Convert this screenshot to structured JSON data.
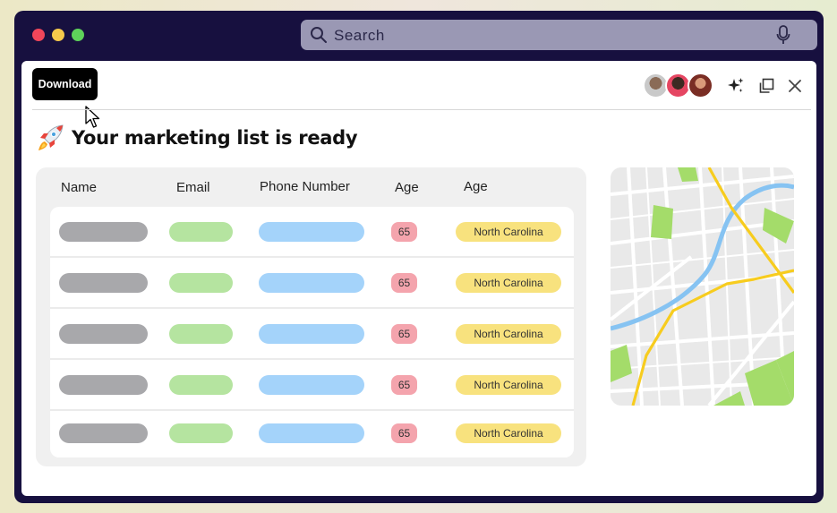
{
  "search": {
    "placeholder": "Search",
    "icon": "search-icon",
    "mic_icon": "microphone-icon"
  },
  "toolbar": {
    "download_label": "Download"
  },
  "heading": {
    "emoji": "rocket-icon",
    "title": "Your marketing list is ready"
  },
  "table": {
    "columns": [
      "Name",
      "Email",
      "Phone Number",
      "Age",
      "Age"
    ],
    "rows": [
      {
        "age": "65",
        "location": "North Carolina"
      },
      {
        "age": "65",
        "location": "North Carolina"
      },
      {
        "age": "65",
        "location": "North Carolina"
      },
      {
        "age": "65",
        "location": "North Carolina"
      },
      {
        "age": "65",
        "location": "North Carolina"
      }
    ]
  },
  "colors": {
    "window_frame": "#17103f",
    "name_pill": "#a8a8ab",
    "email_pill": "#b5e4a0",
    "phone_pill": "#a4d3fa",
    "age_badge": "#f4a4ad",
    "location_badge": "#f8e27e"
  }
}
